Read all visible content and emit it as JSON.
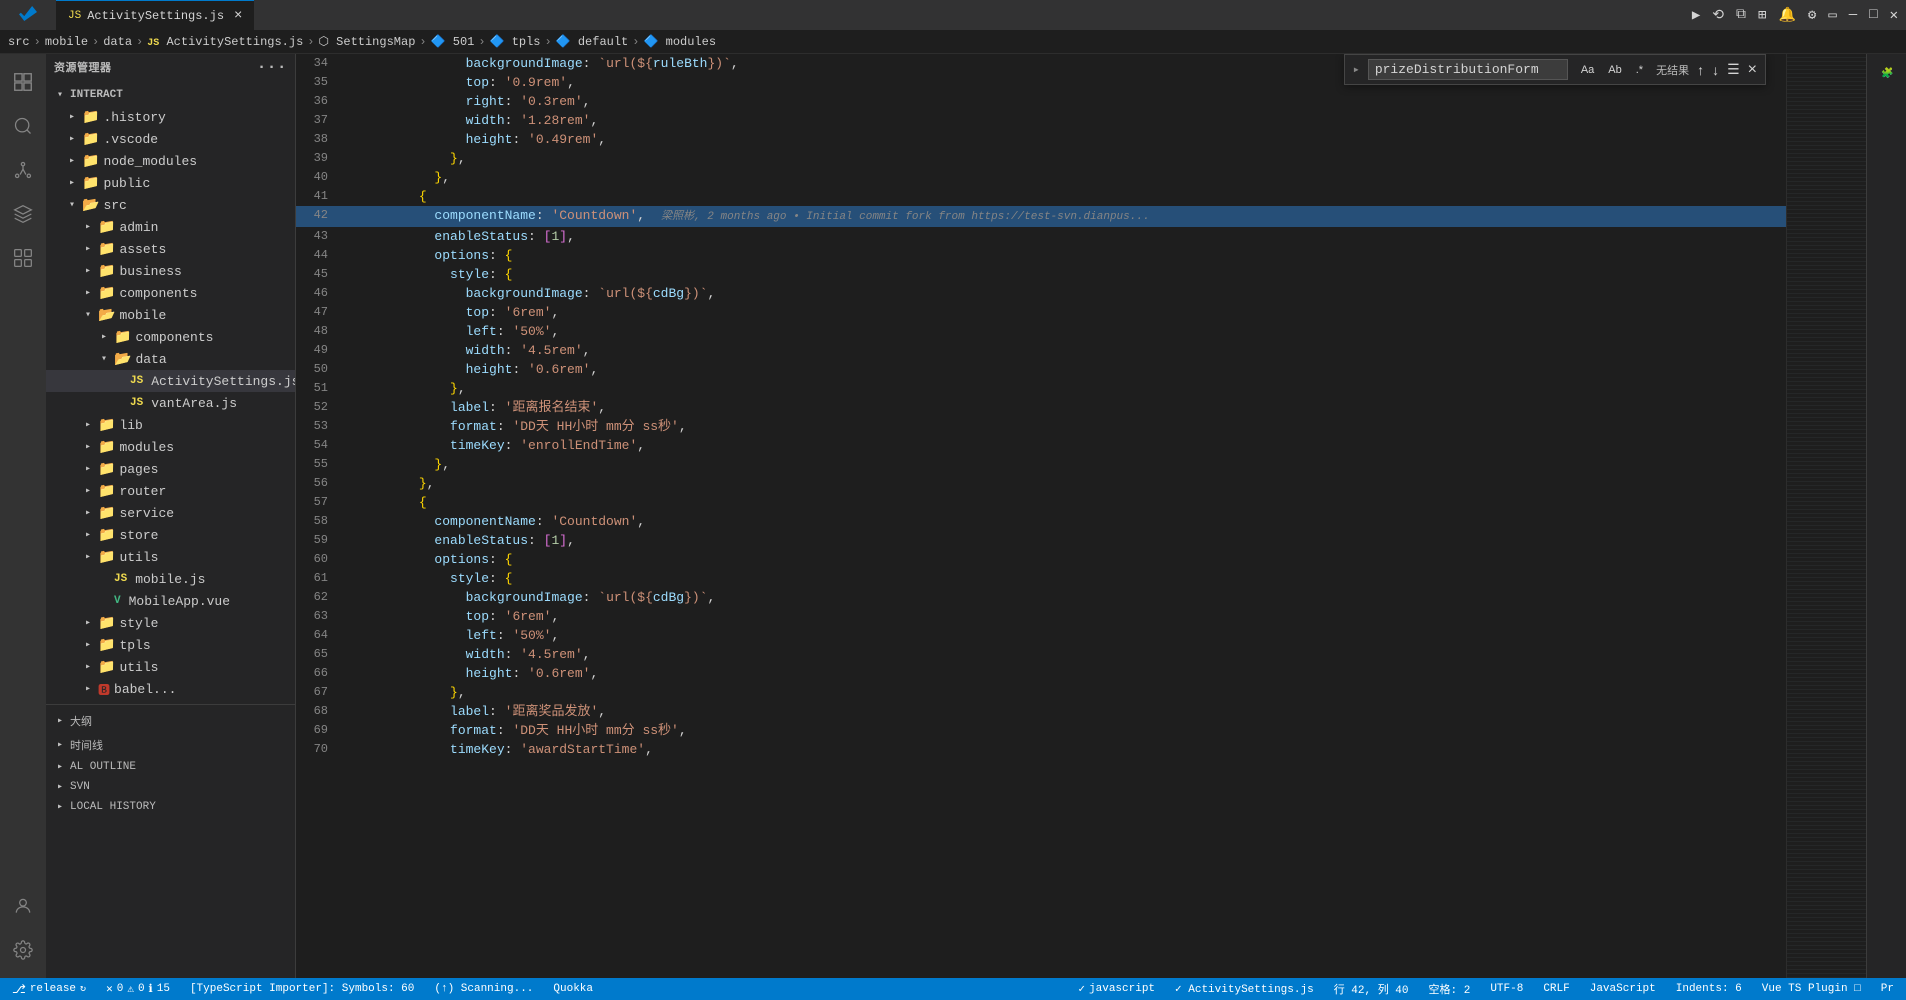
{
  "title": "资源管理器",
  "tab": {
    "label": "ActivitySettings.js",
    "icon": "JS",
    "close": "×"
  },
  "breadcrumb": {
    "parts": [
      "src",
      "mobile",
      "data",
      "JS ActivitySettings.js",
      "SettingsMap",
      "501",
      "tpls",
      "default",
      "modules"
    ]
  },
  "sidebar": {
    "header": "INTERACT",
    "items": [
      {
        "label": ".history",
        "type": "folder",
        "indent": 1,
        "open": false
      },
      {
        "label": ".vscode",
        "type": "folder",
        "indent": 1,
        "open": false
      },
      {
        "label": "node_modules",
        "type": "folder",
        "indent": 1,
        "open": false
      },
      {
        "label": "public",
        "type": "folder",
        "indent": 1,
        "open": false
      },
      {
        "label": "src",
        "type": "folder",
        "indent": 1,
        "open": true
      },
      {
        "label": "admin",
        "type": "folder",
        "indent": 2,
        "open": false
      },
      {
        "label": "assets",
        "type": "folder",
        "indent": 2,
        "open": false
      },
      {
        "label": "business",
        "type": "folder",
        "indent": 2,
        "open": false
      },
      {
        "label": "components",
        "type": "folder",
        "indent": 2,
        "open": false
      },
      {
        "label": "mobile",
        "type": "folder",
        "indent": 2,
        "open": true
      },
      {
        "label": "components",
        "type": "folder",
        "indent": 3,
        "open": false
      },
      {
        "label": "data",
        "type": "folder",
        "indent": 3,
        "open": true
      },
      {
        "label": "ActivitySettings.js",
        "type": "file-js",
        "indent": 4,
        "active": true
      },
      {
        "label": "vantArea.js",
        "type": "file-js",
        "indent": 4
      },
      {
        "label": "lib",
        "type": "folder",
        "indent": 2,
        "open": false
      },
      {
        "label": "modules",
        "type": "folder",
        "indent": 2,
        "open": false
      },
      {
        "label": "pages",
        "type": "folder",
        "indent": 2,
        "open": false
      },
      {
        "label": "router",
        "type": "folder",
        "indent": 2,
        "open": false
      },
      {
        "label": "service",
        "type": "folder",
        "indent": 2,
        "open": false
      },
      {
        "label": "store",
        "type": "folder",
        "indent": 2,
        "open": false
      },
      {
        "label": "utils",
        "type": "folder",
        "indent": 2,
        "open": false
      },
      {
        "label": "mobile.js",
        "type": "file-js",
        "indent": 3
      },
      {
        "label": "MobileApp.vue",
        "type": "file-vue",
        "indent": 3
      },
      {
        "label": "style",
        "type": "folder",
        "indent": 2,
        "open": false
      },
      {
        "label": "tpls",
        "type": "folder",
        "indent": 2,
        "open": false
      },
      {
        "label": "utils",
        "type": "folder",
        "indent": 2,
        "open": false
      },
      {
        "label": "babel...",
        "type": "folder",
        "indent": 2,
        "open": false
      }
    ],
    "bottomSections": [
      {
        "label": "大纲"
      },
      {
        "label": "时间线"
      },
      {
        "label": "AL OUTLINE"
      },
      {
        "label": "SVN"
      },
      {
        "label": "LOCAL HISTORY"
      }
    ]
  },
  "findWidget": {
    "query": "prizeDistributionForm",
    "result": "无结果",
    "options": [
      "Aa",
      "Ab",
      ".*"
    ]
  },
  "editor": {
    "lines": [
      {
        "num": 34,
        "content": "            backgroundImage: `url(${ruleBth})`,"
      },
      {
        "num": 35,
        "content": "            top: '0.9rem',"
      },
      {
        "num": 36,
        "content": "            right: '0.3rem',"
      },
      {
        "num": 37,
        "content": "            width: '1.28rem',"
      },
      {
        "num": 38,
        "content": "            height: '0.49rem',"
      },
      {
        "num": 39,
        "content": "          },"
      },
      {
        "num": 40,
        "content": "        },"
      },
      {
        "num": 41,
        "content": "      {"
      },
      {
        "num": 42,
        "content": "        componentName: 'Countdown',",
        "blame": "梁照彬, 2 months ago • Initial commit fork from https://test-svn.dianpus..."
      },
      {
        "num": 43,
        "content": "        enableStatus: [1],"
      },
      {
        "num": 44,
        "content": "        options: {"
      },
      {
        "num": 45,
        "content": "          style: {"
      },
      {
        "num": 46,
        "content": "            backgroundImage: `url(${cdBg})`,"
      },
      {
        "num": 47,
        "content": "            top: '6rem',"
      },
      {
        "num": 48,
        "content": "            left: '50%',"
      },
      {
        "num": 49,
        "content": "            width: '4.5rem',"
      },
      {
        "num": 50,
        "content": "            height: '0.6rem',"
      },
      {
        "num": 51,
        "content": "          },"
      },
      {
        "num": 52,
        "content": "          label: '距离报名结束',"
      },
      {
        "num": 53,
        "content": "          format: 'DD天 HH小时 mm分 ss秒',"
      },
      {
        "num": 54,
        "content": "          timeKey: 'enrollEndTime',"
      },
      {
        "num": 55,
        "content": "        },"
      },
      {
        "num": 56,
        "content": "      },"
      },
      {
        "num": 57,
        "content": "      {"
      },
      {
        "num": 58,
        "content": "        componentName: 'Countdown',"
      },
      {
        "num": 59,
        "content": "        enableStatus: [1],"
      },
      {
        "num": 60,
        "content": "        options: {"
      },
      {
        "num": 61,
        "content": "          style: {"
      },
      {
        "num": 62,
        "content": "            backgroundImage: `url(${cdBg})`,"
      },
      {
        "num": 63,
        "content": "            top: '6rem',"
      },
      {
        "num": 64,
        "content": "            left: '50%',"
      },
      {
        "num": 65,
        "content": "            width: '4.5rem',"
      },
      {
        "num": 66,
        "content": "            height: '0.6rem',"
      },
      {
        "num": 67,
        "content": "          },"
      },
      {
        "num": 68,
        "content": "          label: '距离奖品发放',"
      },
      {
        "num": 69,
        "content": "          format: 'DD天 HH小时 mm分 ss秒',"
      },
      {
        "num": 70,
        "content": "          timeKey: 'awardStartTime',"
      }
    ]
  },
  "statusBar": {
    "release": "release",
    "errors": "0",
    "warnings": "0",
    "info": "15",
    "tsImporter": "[TypeScript Importer]: Symbols: 60",
    "scanning": "(↑) Scanning...",
    "quokka": "Quokka",
    "eslint": "javascript",
    "checkmark": "✓ ActivitySettings.js",
    "line": "行 42, 列 40",
    "spaces": "空格: 2",
    "encoding": "UTF-8",
    "lineEnding": "CRLF",
    "language": "JavaScript",
    "indents": "Indents: 6",
    "vuePlugin": "Vue TS Plugin □",
    "pr": "Pr"
  }
}
